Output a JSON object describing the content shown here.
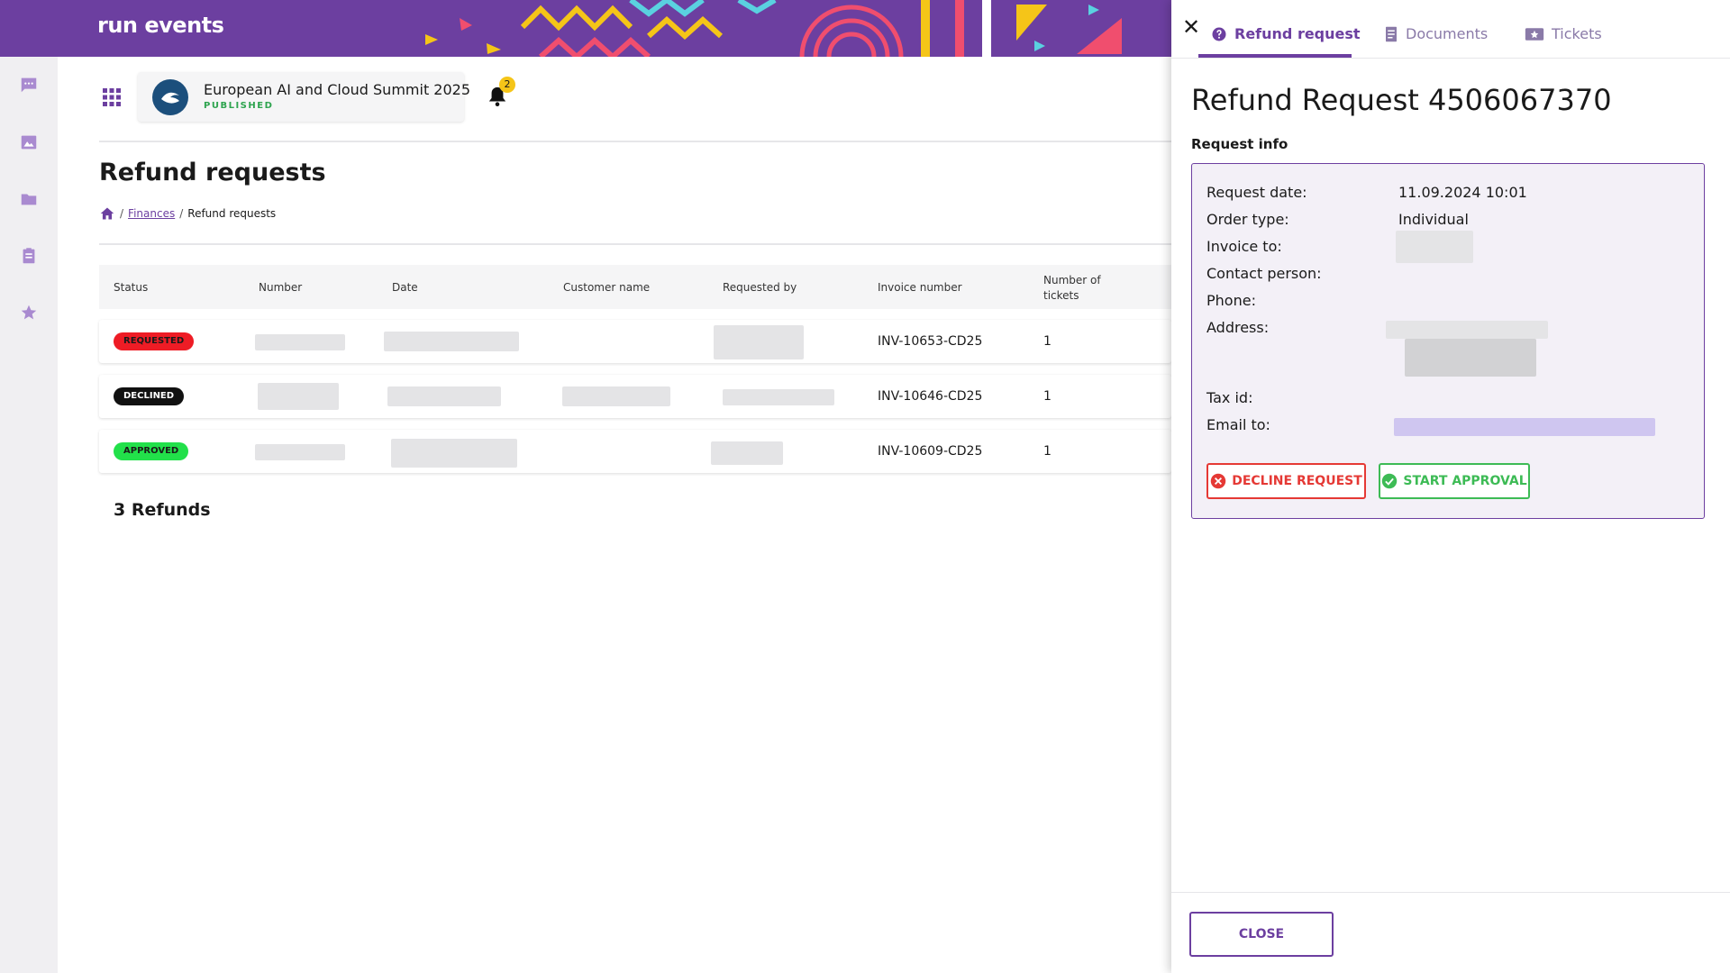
{
  "app": {
    "logo_text": "run events",
    "brand_color": "#6c3fa0"
  },
  "rail": {
    "icons": [
      "chat-icon",
      "image-icon",
      "folder-icon",
      "clipboard-icon",
      "star-icon"
    ]
  },
  "event": {
    "title": "European AI and Cloud Summit 2025",
    "status": "PUBLISHED"
  },
  "notifications": {
    "count": "2"
  },
  "page": {
    "title": "Refund requests",
    "breadcrumb": {
      "link": "Finances",
      "current": "Refund requests"
    }
  },
  "table": {
    "headers": {
      "status": "Status",
      "number": "Number",
      "date": "Date",
      "customer": "Customer name",
      "requested_by": "Requested by",
      "invoice": "Invoice number",
      "tickets": "Number of tickets"
    },
    "rows": [
      {
        "status": "REQUESTED",
        "invoice": "INV-10653-CD25",
        "tickets": "1"
      },
      {
        "status": "DECLINED",
        "invoice": "INV-10646-CD25",
        "tickets": "1"
      },
      {
        "status": "APPROVED",
        "invoice": "INV-10609-CD25",
        "tickets": "1"
      }
    ],
    "footer": "3 Refunds"
  },
  "drawer": {
    "tabs": [
      "Refund request",
      "Documents",
      "Tickets"
    ],
    "title": "Refund Request 4506067370",
    "section": "Request info",
    "fields": {
      "request_date_label": "Request date:",
      "request_date": "11.09.2024 10:01",
      "order_type_label": "Order type:",
      "order_type": "Individual",
      "invoice_to_label": "Invoice to:",
      "contact_label": "Contact person:",
      "phone_label": "Phone:",
      "address_label": "Address:",
      "tax_label": "Tax id:",
      "email_label": "Email to:"
    },
    "decline_label": "DECLINE REQUEST",
    "approve_label": "START APPROVAL",
    "close_label": "CLOSE"
  }
}
